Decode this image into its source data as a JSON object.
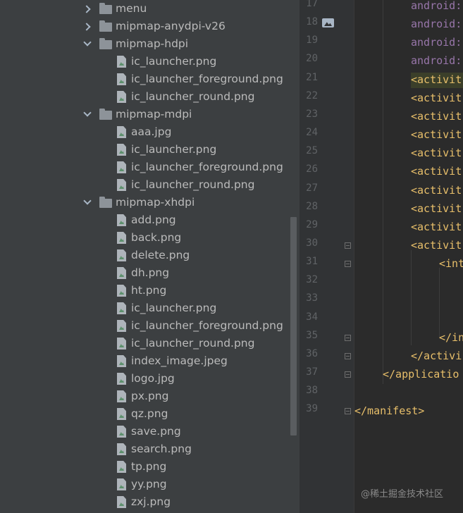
{
  "tree": {
    "rows": [
      {
        "kind": "folder",
        "state": "collapsed",
        "label": "menu"
      },
      {
        "kind": "folder",
        "state": "collapsed",
        "label": "mipmap-anydpi-v26"
      },
      {
        "kind": "folder",
        "state": "expanded",
        "label": "mipmap-hdpi"
      },
      {
        "kind": "file",
        "label": "ic_launcher.png"
      },
      {
        "kind": "file",
        "label": "ic_launcher_foreground.png"
      },
      {
        "kind": "file",
        "label": "ic_launcher_round.png"
      },
      {
        "kind": "folder",
        "state": "expanded",
        "label": "mipmap-mdpi"
      },
      {
        "kind": "file",
        "label": "aaa.jpg"
      },
      {
        "kind": "file",
        "label": "ic_launcher.png"
      },
      {
        "kind": "file",
        "label": "ic_launcher_foreground.png"
      },
      {
        "kind": "file",
        "label": "ic_launcher_round.png"
      },
      {
        "kind": "folder",
        "state": "expanded",
        "label": "mipmap-xhdpi"
      },
      {
        "kind": "file",
        "label": "add.png"
      },
      {
        "kind": "file",
        "label": "back.png"
      },
      {
        "kind": "file",
        "label": "delete.png"
      },
      {
        "kind": "file",
        "label": "dh.png"
      },
      {
        "kind": "file",
        "label": "ht.png"
      },
      {
        "kind": "file",
        "label": "ic_launcher.png"
      },
      {
        "kind": "file",
        "label": "ic_launcher_foreground.png"
      },
      {
        "kind": "file",
        "label": "ic_launcher_round.png"
      },
      {
        "kind": "file",
        "label": "index_image.jpeg"
      },
      {
        "kind": "file",
        "label": "logo.jpg"
      },
      {
        "kind": "file",
        "label": "px.png"
      },
      {
        "kind": "file",
        "label": "qz.png"
      },
      {
        "kind": "file",
        "label": "save.png"
      },
      {
        "kind": "file",
        "label": "search.png"
      },
      {
        "kind": "file",
        "label": "tp.png"
      },
      {
        "kind": "file",
        "label": "yy.png"
      },
      {
        "kind": "file",
        "label": "zxj.png"
      }
    ]
  },
  "gutter": {
    "line_numbers": [
      "17",
      "18",
      "19",
      "20",
      "21",
      "22",
      "23",
      "24",
      "25",
      "26",
      "27",
      "28",
      "29",
      "30",
      "31",
      "32",
      "33",
      "34",
      "35",
      "36",
      "37",
      "38",
      "39"
    ],
    "image_icon": "image-icon"
  },
  "editor": {
    "lines": [
      {
        "indent": 2,
        "parts": [
          {
            "t": "android:",
            "c": "attr"
          }
        ]
      },
      {
        "indent": 2,
        "parts": [
          {
            "t": "android:",
            "c": "attr"
          }
        ]
      },
      {
        "indent": 2,
        "parts": [
          {
            "t": "android:",
            "c": "attr"
          }
        ]
      },
      {
        "indent": 2,
        "parts": [
          {
            "t": "android:",
            "c": "attr"
          }
        ]
      },
      {
        "indent": 2,
        "parts": [
          {
            "t": "<activit",
            "c": "tag"
          }
        ],
        "highlight": true
      },
      {
        "indent": 2,
        "parts": [
          {
            "t": "<activit",
            "c": "tag"
          }
        ]
      },
      {
        "indent": 2,
        "parts": [
          {
            "t": "<activit",
            "c": "tag"
          }
        ]
      },
      {
        "indent": 2,
        "parts": [
          {
            "t": "<activit",
            "c": "tag"
          }
        ]
      },
      {
        "indent": 2,
        "parts": [
          {
            "t": "<activit",
            "c": "tag"
          }
        ]
      },
      {
        "indent": 2,
        "parts": [
          {
            "t": "<activit",
            "c": "tag"
          }
        ]
      },
      {
        "indent": 2,
        "parts": [
          {
            "t": "<activit",
            "c": "tag"
          }
        ]
      },
      {
        "indent": 2,
        "parts": [
          {
            "t": "<activit",
            "c": "tag"
          }
        ]
      },
      {
        "indent": 2,
        "parts": [
          {
            "t": "<activit",
            "c": "tag"
          }
        ]
      },
      {
        "indent": 2,
        "parts": [
          {
            "t": "<activit",
            "c": "tag"
          }
        ]
      },
      {
        "indent": 3,
        "parts": [
          {
            "t": "<int",
            "c": "tag"
          }
        ]
      },
      {
        "indent": 0,
        "parts": []
      },
      {
        "indent": 0,
        "parts": []
      },
      {
        "indent": 0,
        "parts": []
      },
      {
        "indent": 3,
        "parts": [
          {
            "t": "</in",
            "c": "tag"
          }
        ]
      },
      {
        "indent": 2,
        "parts": [
          {
            "t": "</activi",
            "c": "tag"
          }
        ]
      },
      {
        "indent": 1,
        "parts": [
          {
            "t": "</applicatio",
            "c": "tag"
          }
        ]
      },
      {
        "indent": 0,
        "parts": []
      },
      {
        "indent": 0,
        "parts": [
          {
            "t": "</manifest>",
            "c": "tag"
          }
        ]
      }
    ]
  },
  "colors": {
    "tag": "#e8bf6a",
    "attr": "#9876aa",
    "line_number": "#606366",
    "tree_text": "#bbbbbb"
  },
  "watermark": "@稀土掘金技术社区"
}
